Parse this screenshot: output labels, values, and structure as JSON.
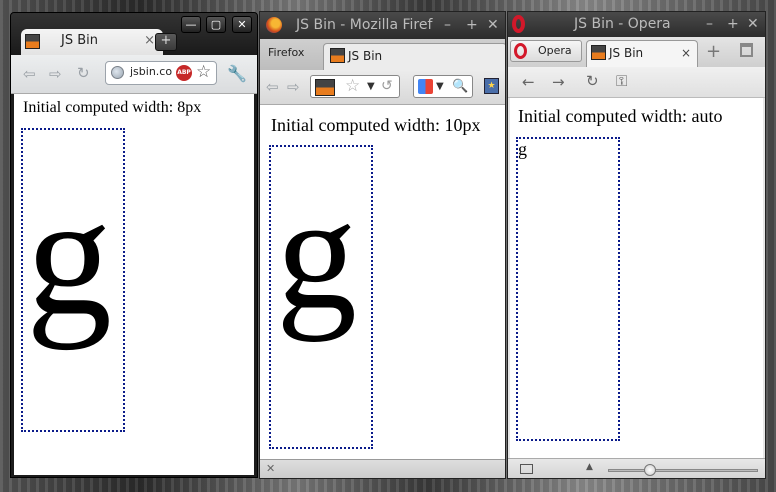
{
  "chrome": {
    "tab_title": "JS Bin",
    "tab_close": "×",
    "new_tab": "+",
    "window_controls": [
      "—",
      "▢",
      "✕"
    ],
    "omnibox_url": "jsbin.co",
    "abp_badge": "ABP",
    "page_text": "Initial computed width: 8px",
    "big_glyph": "g"
  },
  "firefox": {
    "window_title": "JS Bin - Mozilla Firef",
    "window_controls": [
      "–",
      "+",
      "✕"
    ],
    "firefox_button": "Firefox",
    "tab_title": "JS Bin",
    "page_text": "Initial computed width: 10px",
    "big_glyph": "g"
  },
  "opera": {
    "window_title": "JS Bin - Opera",
    "window_controls": [
      "–",
      "+",
      "✕"
    ],
    "menu_label": "Opera",
    "tab_title": "JS Bin",
    "tab_close": "×",
    "page_text": "Initial computed width: auto",
    "small_glyph": "g",
    "zoom_level_fraction": 0.28
  },
  "icons": {
    "back": "back-arrow-icon",
    "forward": "forward-arrow-icon",
    "reload": "reload-icon",
    "star": "bookmark-star-icon",
    "wrench": "wrench-icon",
    "key": "key-icon"
  }
}
